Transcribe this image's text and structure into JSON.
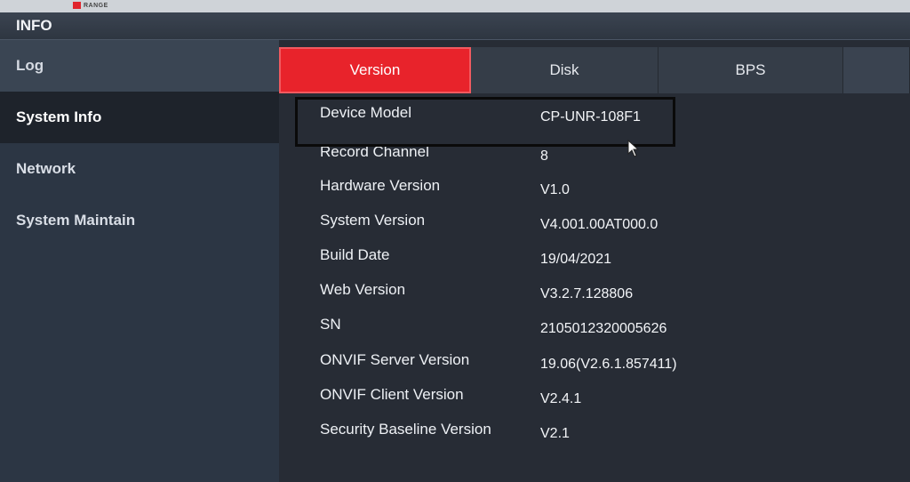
{
  "brand": {
    "text": "RANGE"
  },
  "window": {
    "title": "INFO"
  },
  "sidebar": {
    "items": [
      {
        "label": "Log"
      },
      {
        "label": "System Info"
      },
      {
        "label": "Network"
      },
      {
        "label": "System Maintain"
      }
    ]
  },
  "tabs": [
    {
      "label": "Version"
    },
    {
      "label": "Disk"
    },
    {
      "label": "BPS"
    }
  ],
  "info": {
    "rows": [
      {
        "label": "Device Model",
        "value": "CP-UNR-108F1"
      },
      {
        "label": "Record Channel",
        "value": "8"
      },
      {
        "label": "Hardware Version",
        "value": "V1.0"
      },
      {
        "label": "System Version",
        "value": "V4.001.00AT000.0"
      },
      {
        "label": "Build Date",
        "value": "19/04/2021"
      },
      {
        "label": "Web Version",
        "value": "V3.2.7.128806"
      },
      {
        "label": "SN",
        "value": "2105012320005626"
      },
      {
        "label": "ONVIF Server Version",
        "value": "19.06(V2.6.1.857411)"
      },
      {
        "label": "ONVIF Client Version",
        "value": "V2.4.1"
      },
      {
        "label": "Security Baseline Version",
        "value": "V2.1"
      }
    ]
  },
  "colors": {
    "accent": "#e8232b",
    "sidebar": "#2c3644",
    "panel": "#272c35"
  }
}
